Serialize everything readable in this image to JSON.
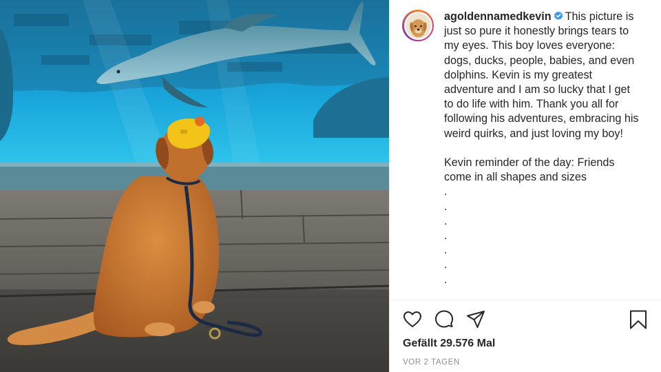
{
  "post": {
    "username": "agoldennamedkevin",
    "verified": true,
    "caption_lines": [
      "This picture is",
      "just so pure it honestly brings tears to",
      "my eyes. This boy loves everyone:",
      "dogs, ducks, people, babies, and even",
      "dolphins. Kevin is my greatest",
      "adventure and I am so lucky that I get",
      "to do life with him. Thank you all for",
      "following his adventures, embracing his",
      "weird quirks, and just loving my boy!",
      "",
      "Kevin reminder of the day: Friends",
      "come in all shapes and sizes",
      ".",
      ".",
      ".",
      ".",
      ".",
      ".",
      "."
    ],
    "likes_text": "Gefällt 29.576 Mal",
    "timestamp": "VOR 2 TAGEN"
  },
  "icons": [
    "heart-icon",
    "comment-icon",
    "share-icon",
    "bookmark-icon",
    "verified-badge-icon"
  ],
  "colors": {
    "verified_blue": "#3897f0",
    "text": "#262626",
    "muted": "#8e8e8e",
    "water": "#1ea6d6",
    "water_dark": "#0b5f8f",
    "dog_fur": "#c8742e",
    "cap_yellow": "#f2c318"
  }
}
